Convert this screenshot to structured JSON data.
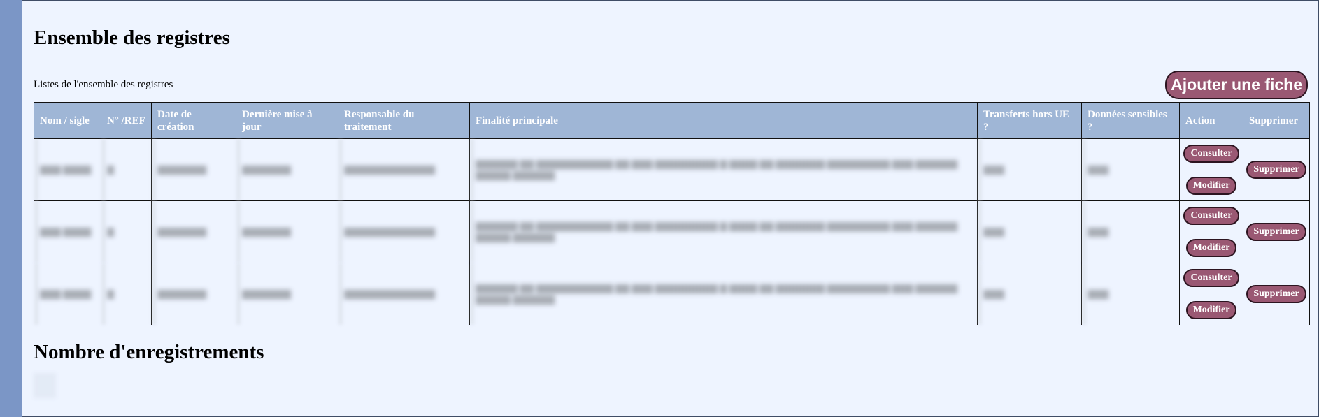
{
  "page": {
    "title": "Ensemble des registres",
    "subtitle": "Listes de l'ensemble des registres",
    "add_button": "Ajouter une fiche",
    "count_title": "Nombre d'enregistrements"
  },
  "table": {
    "headers": [
      "Nom / sigle",
      "N° /REF",
      "Date de création",
      "Dernière mise à jour",
      "Responsable du traitement",
      "Finalité principale",
      "Transferts hors UE ?",
      "Données sensibles ?",
      "Action",
      "Supprimer"
    ],
    "action_labels": {
      "view": "Consulter",
      "edit": "Modifier",
      "delete": "Supprimer"
    },
    "rows": [
      {
        "redacted": true
      },
      {
        "redacted": true
      },
      {
        "redacted": true
      }
    ]
  },
  "colors": {
    "accent_button": "#9a5873",
    "header_bg": "#9fb6d6",
    "page_bg": "#eef4ff",
    "sidebar": "#7b96c6"
  }
}
